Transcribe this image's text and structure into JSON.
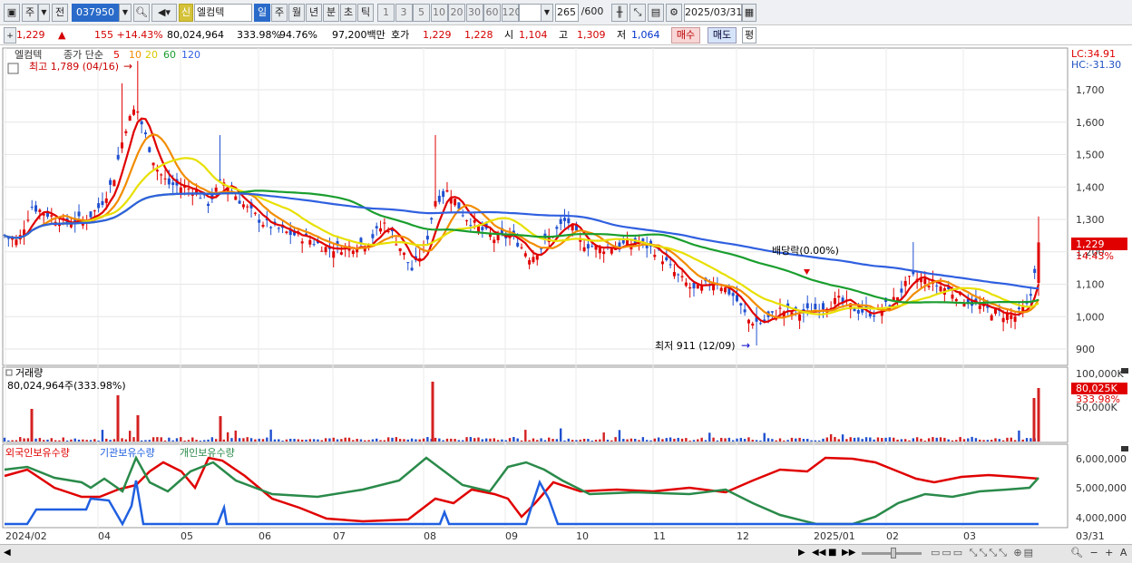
{
  "toolbar": {
    "mode": "주",
    "prev": "전",
    "code": "037950",
    "badge": "신",
    "name": "엘컴텍",
    "periods": [
      "일",
      "주",
      "월",
      "년",
      "분",
      "초",
      "틱"
    ],
    "active_period": "일",
    "intervals": [
      "1",
      "3",
      "5",
      "10",
      "20",
      "30",
      "60",
      "120"
    ],
    "count": "265",
    "count_total": "/600",
    "date": "2025/03/31"
  },
  "info": {
    "price": "1,229",
    "change": "155 +14.43%",
    "volume": "80,024,964",
    "vol_ratio": "333.98%",
    "turnover": "94.76%",
    "amount": "97,200백만",
    "quote_label": "호가",
    "ask": "1,229",
    "bid": "1,228",
    "open_label": "시",
    "open": "1,104",
    "high_label": "고",
    "high": "1,309",
    "low_label": "저",
    "low": "1,064",
    "buy": "매수",
    "sell": "매도",
    "eval": "평"
  },
  "price_panel": {
    "legend_name": "엘컴텍",
    "legend_ma": "종가 단순",
    "ma_periods": [
      "5",
      "10",
      "20",
      "60",
      "120"
    ],
    "ma_colors": [
      "#e00000",
      "#f28c00",
      "#e8e000",
      "#1a9e2e",
      "#3060e0"
    ],
    "high_note": "최고 1,789 (04/16)",
    "low_note": "최저 911 (12/09)",
    "dividend_note": "배당락(0.00%)",
    "lc": "LC:34.91",
    "hc": "HC:-31.30",
    "price_tag": "1,229",
    "pct_tag": "14.43%",
    "y_ticks": [
      "1,700",
      "1,600",
      "1,500",
      "1,400",
      "1,300",
      "1,200",
      "1,100",
      "1,000",
      "900"
    ]
  },
  "volume_panel": {
    "title": "거래량",
    "value": "80,024,964주(333.98%)",
    "y_ticks": [
      "100,000K",
      "50,000K"
    ],
    "tag": "80,025K",
    "tag_pct": "333.98%"
  },
  "holding_panel": {
    "legend": [
      "외국인보유수량",
      "기관보유수량",
      "개인보유수량"
    ],
    "colors": [
      "#e00000",
      "#2060e0",
      "#2a8a4a"
    ],
    "y_ticks": [
      "6,000,000",
      "5,000,000",
      "4,000,000"
    ]
  },
  "x_axis": {
    "labels": [
      "2024/02",
      "04",
      "05",
      "06",
      "07",
      "08",
      "09",
      "10",
      "11",
      "12",
      "2025/01",
      "02",
      "03"
    ],
    "end_label": "03/31"
  }
}
